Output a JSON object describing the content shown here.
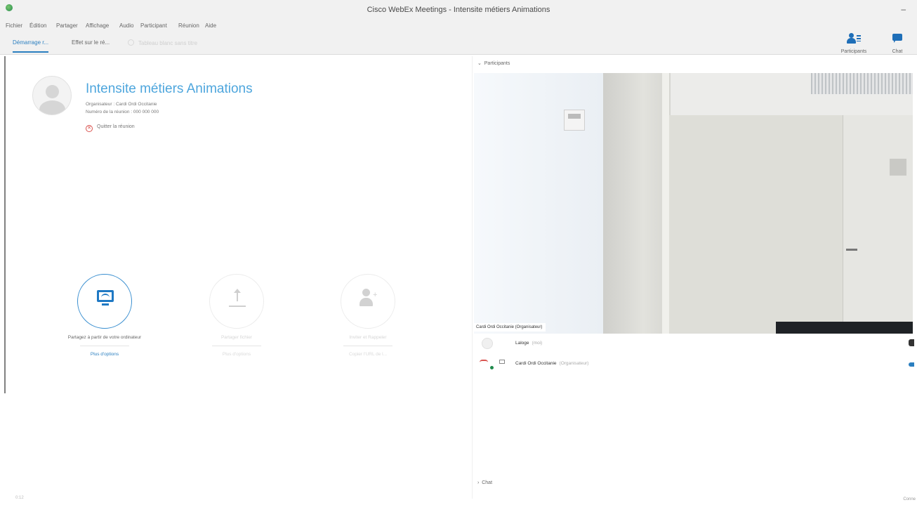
{
  "window": {
    "title": "Cisco WebEx Meetings - Intensite métiers Animations",
    "minimize": "–"
  },
  "menu": [
    "Fichier",
    "Édition",
    "Partager",
    "Affichage",
    "Audio",
    "Participant",
    "Réunion",
    "Aide"
  ],
  "tabs": [
    {
      "label": "Démarrage r...",
      "state": "active"
    },
    {
      "label": "Effet sur le ré...",
      "state": "normal"
    },
    {
      "label": "Tableau blanc sans titre",
      "state": "disabled"
    }
  ],
  "toolbar": {
    "participants_label": "Participants",
    "chat_label": "Chat"
  },
  "meeting": {
    "title": "Intensite métiers Animations",
    "host_line": "Organisateur :   Cardi Ordi Occitanie",
    "number_line": "Numéro de la réunion :   000 000 000",
    "leave_label": "Quitter la réunion"
  },
  "actions": [
    {
      "caption": "Partagez à partir de votre ordinateur",
      "sub": "Plus d'options"
    },
    {
      "caption": "Partager fichier",
      "sub": "Plus d'options"
    },
    {
      "caption": "Inviter et Rappeler",
      "sub": "Copier l'URL de l..."
    }
  ],
  "participants": {
    "header": "Participants",
    "video_caption": "Cardi Ordi Occitanie (Organisateur)",
    "rows": [
      {
        "name": "Laloge",
        "role": "(moi)"
      },
      {
        "name": "Cardi Ordi Occitanie",
        "role": "(Organisateur)"
      }
    ]
  },
  "chat": {
    "header": "Chat"
  },
  "status": {
    "left": "0:12",
    "right": "Conne"
  },
  "colors": {
    "accent": "#2b7fc0",
    "title_blue": "#4ea6dd",
    "leave_red": "#d9534f"
  }
}
